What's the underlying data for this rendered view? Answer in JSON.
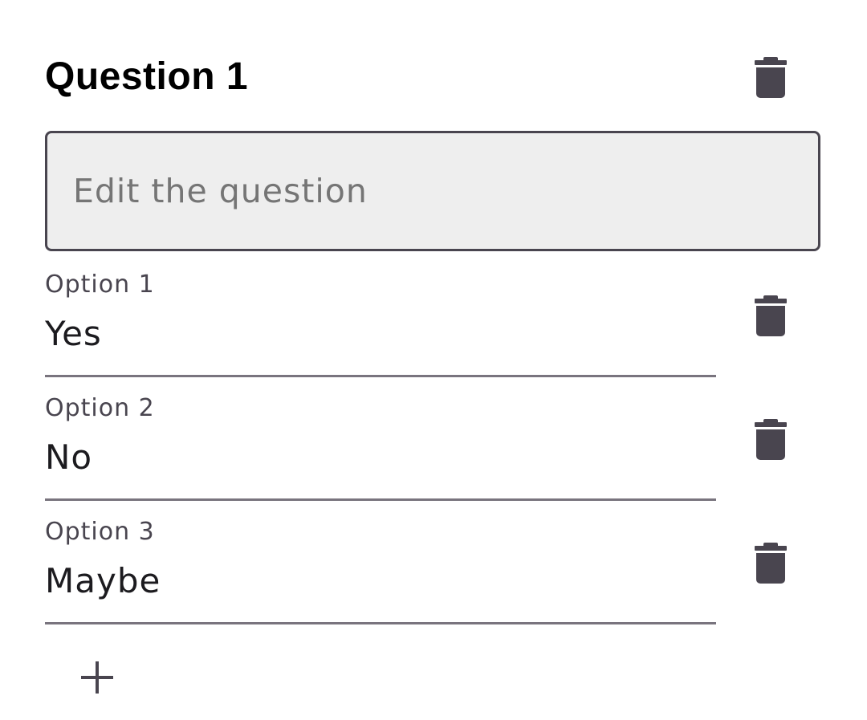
{
  "question": {
    "title": "Question 1",
    "placeholder": "Edit the question",
    "value": "",
    "delete_icon": "trash-icon"
  },
  "options": [
    {
      "label": "Option 1",
      "value": "Yes",
      "delete_icon": "trash-icon"
    },
    {
      "label": "Option 2",
      "value": "No",
      "delete_icon": "trash-icon"
    },
    {
      "label": "Option 3",
      "value": "Maybe",
      "delete_icon": "trash-icon"
    }
  ],
  "add_option": {
    "icon": "plus-icon"
  },
  "colors": {
    "icon": "#49454f",
    "field_background": "#eeeeee",
    "field_border": "#49454f",
    "underline": "#79747e",
    "text": "#1c1b1f",
    "label": "#49454f"
  }
}
